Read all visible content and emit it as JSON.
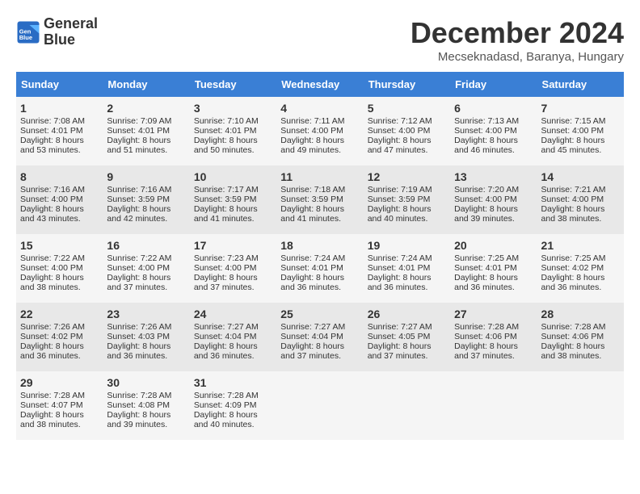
{
  "header": {
    "logo_line1": "General",
    "logo_line2": "Blue",
    "month": "December 2024",
    "location": "Mecseknadasd, Baranya, Hungary"
  },
  "weekdays": [
    "Sunday",
    "Monday",
    "Tuesday",
    "Wednesday",
    "Thursday",
    "Friday",
    "Saturday"
  ],
  "weeks": [
    [
      {
        "day": "1",
        "lines": [
          "Sunrise: 7:08 AM",
          "Sunset: 4:01 PM",
          "Daylight: 8 hours",
          "and 53 minutes."
        ]
      },
      {
        "day": "2",
        "lines": [
          "Sunrise: 7:09 AM",
          "Sunset: 4:01 PM",
          "Daylight: 8 hours",
          "and 51 minutes."
        ]
      },
      {
        "day": "3",
        "lines": [
          "Sunrise: 7:10 AM",
          "Sunset: 4:01 PM",
          "Daylight: 8 hours",
          "and 50 minutes."
        ]
      },
      {
        "day": "4",
        "lines": [
          "Sunrise: 7:11 AM",
          "Sunset: 4:00 PM",
          "Daylight: 8 hours",
          "and 49 minutes."
        ]
      },
      {
        "day": "5",
        "lines": [
          "Sunrise: 7:12 AM",
          "Sunset: 4:00 PM",
          "Daylight: 8 hours",
          "and 47 minutes."
        ]
      },
      {
        "day": "6",
        "lines": [
          "Sunrise: 7:13 AM",
          "Sunset: 4:00 PM",
          "Daylight: 8 hours",
          "and 46 minutes."
        ]
      },
      {
        "day": "7",
        "lines": [
          "Sunrise: 7:15 AM",
          "Sunset: 4:00 PM",
          "Daylight: 8 hours",
          "and 45 minutes."
        ]
      }
    ],
    [
      {
        "day": "8",
        "lines": [
          "Sunrise: 7:16 AM",
          "Sunset: 4:00 PM",
          "Daylight: 8 hours",
          "and 43 minutes."
        ]
      },
      {
        "day": "9",
        "lines": [
          "Sunrise: 7:16 AM",
          "Sunset: 3:59 PM",
          "Daylight: 8 hours",
          "and 42 minutes."
        ]
      },
      {
        "day": "10",
        "lines": [
          "Sunrise: 7:17 AM",
          "Sunset: 3:59 PM",
          "Daylight: 8 hours",
          "and 41 minutes."
        ]
      },
      {
        "day": "11",
        "lines": [
          "Sunrise: 7:18 AM",
          "Sunset: 3:59 PM",
          "Daylight: 8 hours",
          "and 41 minutes."
        ]
      },
      {
        "day": "12",
        "lines": [
          "Sunrise: 7:19 AM",
          "Sunset: 3:59 PM",
          "Daylight: 8 hours",
          "and 40 minutes."
        ]
      },
      {
        "day": "13",
        "lines": [
          "Sunrise: 7:20 AM",
          "Sunset: 4:00 PM",
          "Daylight: 8 hours",
          "and 39 minutes."
        ]
      },
      {
        "day": "14",
        "lines": [
          "Sunrise: 7:21 AM",
          "Sunset: 4:00 PM",
          "Daylight: 8 hours",
          "and 38 minutes."
        ]
      }
    ],
    [
      {
        "day": "15",
        "lines": [
          "Sunrise: 7:22 AM",
          "Sunset: 4:00 PM",
          "Daylight: 8 hours",
          "and 38 minutes."
        ]
      },
      {
        "day": "16",
        "lines": [
          "Sunrise: 7:22 AM",
          "Sunset: 4:00 PM",
          "Daylight: 8 hours",
          "and 37 minutes."
        ]
      },
      {
        "day": "17",
        "lines": [
          "Sunrise: 7:23 AM",
          "Sunset: 4:00 PM",
          "Daylight: 8 hours",
          "and 37 minutes."
        ]
      },
      {
        "day": "18",
        "lines": [
          "Sunrise: 7:24 AM",
          "Sunset: 4:01 PM",
          "Daylight: 8 hours",
          "and 36 minutes."
        ]
      },
      {
        "day": "19",
        "lines": [
          "Sunrise: 7:24 AM",
          "Sunset: 4:01 PM",
          "Daylight: 8 hours",
          "and 36 minutes."
        ]
      },
      {
        "day": "20",
        "lines": [
          "Sunrise: 7:25 AM",
          "Sunset: 4:01 PM",
          "Daylight: 8 hours",
          "and 36 minutes."
        ]
      },
      {
        "day": "21",
        "lines": [
          "Sunrise: 7:25 AM",
          "Sunset: 4:02 PM",
          "Daylight: 8 hours",
          "and 36 minutes."
        ]
      }
    ],
    [
      {
        "day": "22",
        "lines": [
          "Sunrise: 7:26 AM",
          "Sunset: 4:02 PM",
          "Daylight: 8 hours",
          "and 36 minutes."
        ]
      },
      {
        "day": "23",
        "lines": [
          "Sunrise: 7:26 AM",
          "Sunset: 4:03 PM",
          "Daylight: 8 hours",
          "and 36 minutes."
        ]
      },
      {
        "day": "24",
        "lines": [
          "Sunrise: 7:27 AM",
          "Sunset: 4:04 PM",
          "Daylight: 8 hours",
          "and 36 minutes."
        ]
      },
      {
        "day": "25",
        "lines": [
          "Sunrise: 7:27 AM",
          "Sunset: 4:04 PM",
          "Daylight: 8 hours",
          "and 37 minutes."
        ]
      },
      {
        "day": "26",
        "lines": [
          "Sunrise: 7:27 AM",
          "Sunset: 4:05 PM",
          "Daylight: 8 hours",
          "and 37 minutes."
        ]
      },
      {
        "day": "27",
        "lines": [
          "Sunrise: 7:28 AM",
          "Sunset: 4:06 PM",
          "Daylight: 8 hours",
          "and 37 minutes."
        ]
      },
      {
        "day": "28",
        "lines": [
          "Sunrise: 7:28 AM",
          "Sunset: 4:06 PM",
          "Daylight: 8 hours",
          "and 38 minutes."
        ]
      }
    ],
    [
      {
        "day": "29",
        "lines": [
          "Sunrise: 7:28 AM",
          "Sunset: 4:07 PM",
          "Daylight: 8 hours",
          "and 38 minutes."
        ]
      },
      {
        "day": "30",
        "lines": [
          "Sunrise: 7:28 AM",
          "Sunset: 4:08 PM",
          "Daylight: 8 hours",
          "and 39 minutes."
        ]
      },
      {
        "day": "31",
        "lines": [
          "Sunrise: 7:28 AM",
          "Sunset: 4:09 PM",
          "Daylight: 8 hours",
          "and 40 minutes."
        ]
      },
      null,
      null,
      null,
      null
    ]
  ]
}
